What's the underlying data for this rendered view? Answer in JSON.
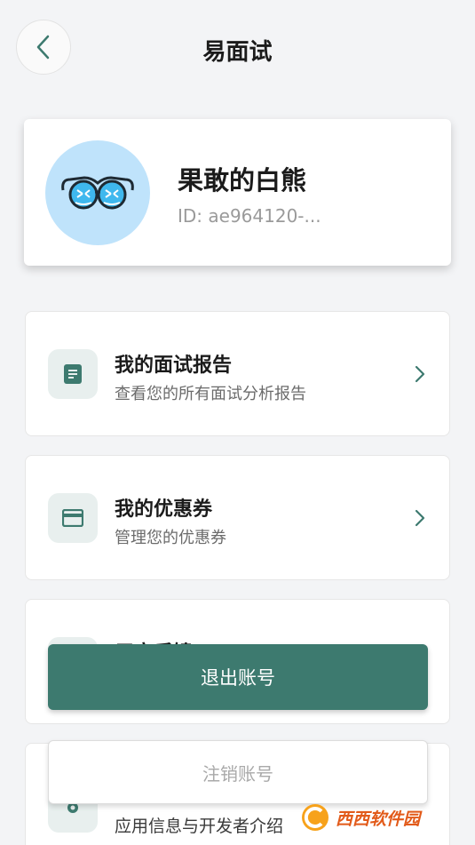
{
  "header": {
    "title": "易面试"
  },
  "profile": {
    "name": "果敢的白熊",
    "id": "ID: ae964120-..."
  },
  "menu": [
    {
      "title": "我的面试报告",
      "subtitle": "查看您的所有面试分析报告",
      "icon": "report-icon"
    },
    {
      "title": "我的优惠券",
      "subtitle": "管理您的优惠券",
      "icon": "card-icon"
    },
    {
      "title": "用户反馈",
      "subtitle": "",
      "icon": "feedback-icon"
    },
    {
      "title": "",
      "subtitle": "应用信息与开发者介绍",
      "icon": "settings-icon"
    }
  ],
  "dialog": {
    "logout_label": "退出账号",
    "cancel_account_label": "注销账号"
  },
  "watermark": {
    "text": "西西软件园"
  },
  "colors": {
    "accent": "#3d7a6f",
    "avatar_bg": "#bfe3fb",
    "background": "#f3f4f6"
  }
}
